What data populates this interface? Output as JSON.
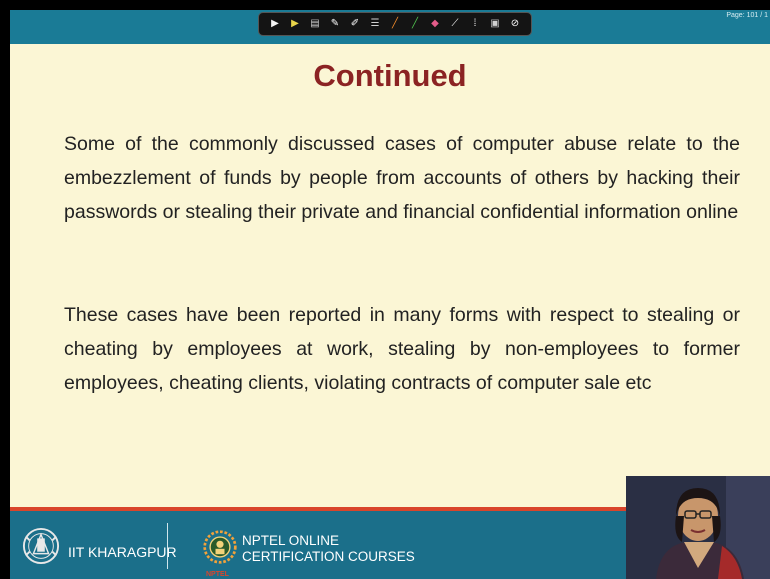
{
  "page_indicator": "Page: 101 / 1",
  "toolbar": {
    "tools": [
      {
        "name": "pointer-icon",
        "glyph": "▶",
        "color": "#f5f5f5"
      },
      {
        "name": "arrow-icon",
        "glyph": "▶",
        "color": "#e9d54a"
      },
      {
        "name": "file-icon",
        "glyph": "▤",
        "color": "#d0d0d0"
      },
      {
        "name": "pen-icon",
        "glyph": "✎",
        "color": "#ffffff"
      },
      {
        "name": "pencil-icon",
        "glyph": "✐",
        "color": "#ffffff"
      },
      {
        "name": "text-icon",
        "glyph": "☰",
        "color": "#d0d0d0"
      },
      {
        "name": "highlighter-icon",
        "glyph": "╱",
        "color": "#f08a2b"
      },
      {
        "name": "marker-icon",
        "glyph": "╱",
        "color": "#4fc24f"
      },
      {
        "name": "eraser-icon",
        "glyph": "◆",
        "color": "#e45c8a"
      },
      {
        "name": "line-icon",
        "glyph": "⟋",
        "color": "#ffffff"
      },
      {
        "name": "dots-icon",
        "glyph": "⁞",
        "color": "#ffffff"
      },
      {
        "name": "screen-icon",
        "glyph": "▣",
        "color": "#d0d0d0"
      },
      {
        "name": "stop-icon",
        "glyph": "⊘",
        "color": "#ffffff"
      }
    ]
  },
  "slide": {
    "title": "Continued",
    "paragraphs": [
      "Some of the commonly discussed cases of computer abuse relate to the embezzlement of funds by people from accounts of others by hacking their passwords or stealing their private and  financial confidential information online",
      "These cases have been reported in many forms with respect to stealing or cheating by employees at work, stealing by non-employees to former employees, cheating clients, violating contracts of computer sale etc"
    ]
  },
  "footer": {
    "iit_label": "IIT KHARAGPUR",
    "nptel_line1": "NPTEL ONLINE",
    "nptel_line2": "CERTIFICATION COURSES",
    "nptel_small": "NPTEL"
  },
  "colors": {
    "title": "#8b2323",
    "slide_bg": "#fbf6d5",
    "topbar": "#1a7b96",
    "footer": "#1b6f8a",
    "accent_line": "#d9452b"
  }
}
